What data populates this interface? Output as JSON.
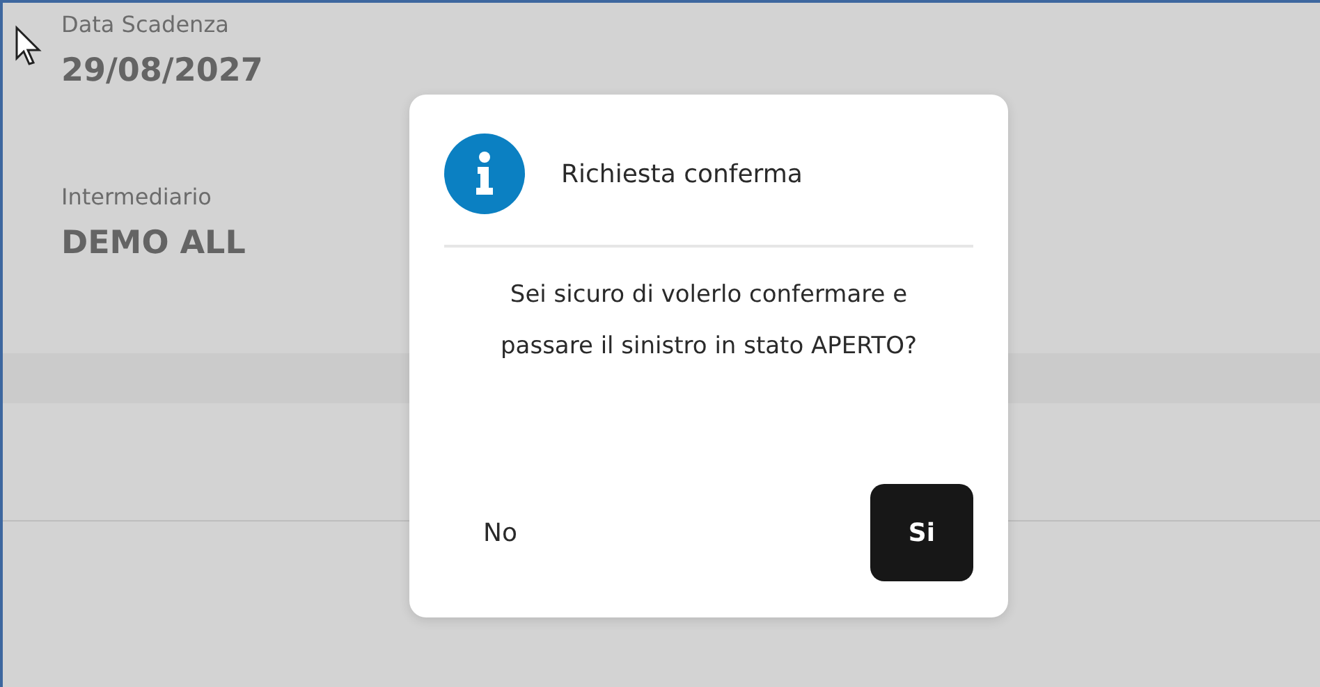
{
  "fields": [
    {
      "label": "Data Scadenza",
      "value": "29/08/2027"
    },
    {
      "label": "Intermediario",
      "value": "DEMO ALL"
    }
  ],
  "dialog": {
    "title": "Richiesta conferma",
    "message": "Sei sicuro di volerlo confermare e passare il sinistro in stato APERTO?",
    "buttons": [
      {
        "label": "No",
        "kind": "text"
      },
      {
        "label": "Si",
        "kind": "primary"
      }
    ]
  }
}
